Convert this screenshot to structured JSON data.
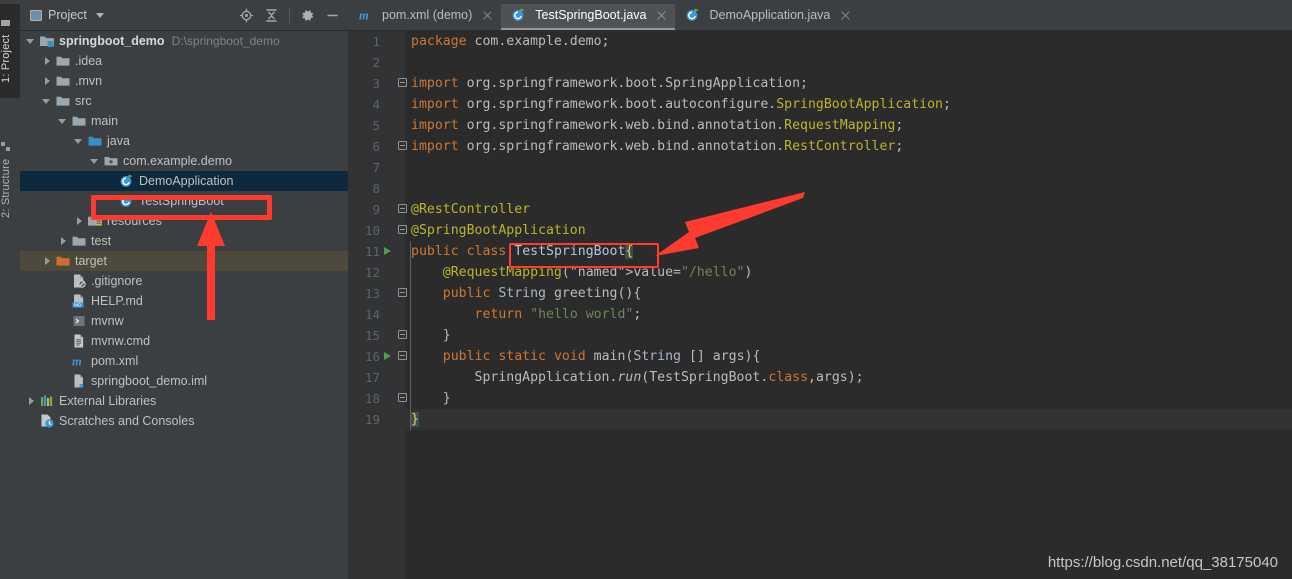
{
  "window": {
    "watermark": "https://blog.csdn.net/qq_38175040"
  },
  "tool_strip": {
    "tabs": [
      {
        "label": "1: Project",
        "icon": "project-icon",
        "active": true
      },
      {
        "label": "2: Structure",
        "icon": "structure-icon",
        "active": false
      }
    ]
  },
  "project_panel": {
    "title": "Project",
    "title_icon": "project-view-icon",
    "dropdown_icon": "chevron-down-icon",
    "toolbar": [
      {
        "name": "locate-icon",
        "tooltip": "Select Opened File"
      },
      {
        "name": "collapse-all-icon",
        "tooltip": "Collapse All"
      },
      {
        "name": "gear-icon",
        "tooltip": "Settings"
      },
      {
        "name": "minimize-icon",
        "tooltip": "Hide"
      }
    ],
    "tree": [
      {
        "label": "springboot_demo",
        "suffix": "D:\\springboot_demo",
        "icon": "module-folder-icon",
        "indent": 0,
        "twisty": "open",
        "bold": true
      },
      {
        "label": ".idea",
        "icon": "folder-icon",
        "indent": 1,
        "twisty": "closed"
      },
      {
        "label": ".mvn",
        "icon": "folder-icon",
        "indent": 1,
        "twisty": "closed"
      },
      {
        "label": "src",
        "icon": "folder-icon",
        "indent": 1,
        "twisty": "open"
      },
      {
        "label": "main",
        "icon": "folder-icon",
        "indent": 2,
        "twisty": "open"
      },
      {
        "label": "java",
        "icon": "source-root-folder-icon",
        "indent": 3,
        "twisty": "open"
      },
      {
        "label": "com.example.demo",
        "icon": "package-icon",
        "indent": 4,
        "twisty": "open"
      },
      {
        "label": "DemoApplication",
        "icon": "java-class-run-icon",
        "indent": 5,
        "twisty": "none",
        "selected": true
      },
      {
        "label": "TestSpringBoot",
        "icon": "java-class-run-icon",
        "indent": 5,
        "twisty": "none",
        "highlighted": true
      },
      {
        "label": "resources",
        "icon": "resources-root-folder-icon",
        "indent": 3,
        "twisty": "closed"
      },
      {
        "label": "test",
        "icon": "folder-icon",
        "indent": 2,
        "twisty": "closed"
      },
      {
        "label": "target",
        "icon": "excluded-folder-icon",
        "indent": 1,
        "twisty": "closed",
        "excluded": true
      },
      {
        "label": ".gitignore",
        "icon": "gitignore-file-icon",
        "indent": 2,
        "twisty": "none"
      },
      {
        "label": "HELP.md",
        "icon": "markdown-file-icon",
        "indent": 2,
        "twisty": "none"
      },
      {
        "label": "mvnw",
        "icon": "shell-file-icon",
        "indent": 2,
        "twisty": "none"
      },
      {
        "label": "mvnw.cmd",
        "icon": "text-file-icon",
        "indent": 2,
        "twisty": "none"
      },
      {
        "label": "pom.xml",
        "icon": "maven-file-icon",
        "indent": 2,
        "twisty": "none"
      },
      {
        "label": "springboot_demo.iml",
        "icon": "iml-file-icon",
        "indent": 2,
        "twisty": "none"
      },
      {
        "label": "External Libraries",
        "icon": "libraries-icon",
        "indent": 0,
        "twisty": "closed"
      },
      {
        "label": "Scratches and Consoles",
        "icon": "scratches-icon",
        "indent": 0,
        "twisty": "none"
      }
    ]
  },
  "editor": {
    "tabs": [
      {
        "label": "pom.xml (demo)",
        "icon": "maven-file-icon",
        "active": false,
        "close_icon": "close-icon"
      },
      {
        "label": "TestSpringBoot.java",
        "icon": "java-class-run-icon",
        "active": true,
        "close_icon": "close-icon"
      },
      {
        "label": "DemoApplication.java",
        "icon": "java-class-run-icon",
        "active": false,
        "close_icon": "close-icon"
      }
    ],
    "lines": [
      {
        "n": "1",
        "text": "package com.example.demo;"
      },
      {
        "n": "2",
        "text": ""
      },
      {
        "n": "3",
        "text": "import org.springframework.boot.SpringApplication;"
      },
      {
        "n": "4",
        "text": "import org.springframework.boot.autoconfigure.SpringBootApplication;"
      },
      {
        "n": "5",
        "text": "import org.springframework.web.bind.annotation.RequestMapping;"
      },
      {
        "n": "6",
        "text": "import org.springframework.web.bind.annotation.RestController;"
      },
      {
        "n": "7",
        "text": ""
      },
      {
        "n": "8",
        "text": ""
      },
      {
        "n": "9",
        "text": "@RestController"
      },
      {
        "n": "10",
        "text": "@SpringBootApplication"
      },
      {
        "n": "11",
        "text": "public class TestSpringBoot{",
        "run_marker": true
      },
      {
        "n": "12",
        "text": "    @RequestMapping(value=\"/hello\")"
      },
      {
        "n": "13",
        "text": "    public String greeting(){"
      },
      {
        "n": "14",
        "text": "        return \"hello world\";"
      },
      {
        "n": "15",
        "text": "    }"
      },
      {
        "n": "16",
        "text": "    public static void main(String [] args){",
        "run_marker": true
      },
      {
        "n": "17",
        "text": "        SpringApplication.run(TestSpringBoot.class,args);"
      },
      {
        "n": "18",
        "text": "    }"
      },
      {
        "n": "19",
        "text": "}"
      }
    ]
  },
  "annotations": {
    "tree_box_target": "TestSpringBoot",
    "code_box_target": "TestSpringBoot{",
    "arrow_color": "#ff3b30",
    "arrows": [
      {
        "name": "tree-callout-arrow",
        "points_to": "TestSpringBoot"
      },
      {
        "name": "code-callout-arrow",
        "points_to": "TestSpringBoot{"
      }
    ]
  }
}
